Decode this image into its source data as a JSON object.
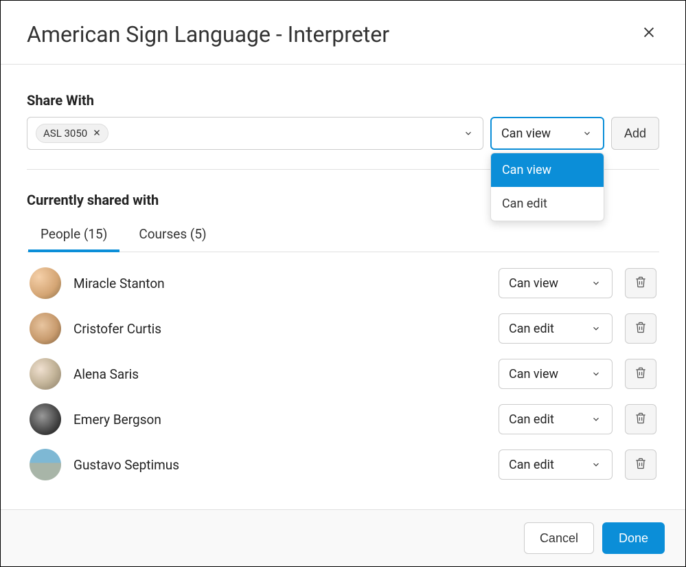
{
  "header": {
    "title": "American Sign Language - Interpreter"
  },
  "share": {
    "label": "Share With",
    "chip": "ASL 3050",
    "permission_selected": "Can view",
    "add_label": "Add",
    "dropdown_options": [
      "Can view",
      "Can edit"
    ]
  },
  "shared": {
    "label": "Currently shared with",
    "tabs": [
      {
        "label": "People (15)",
        "active": true
      },
      {
        "label": "Courses (5)",
        "active": false
      }
    ],
    "people": [
      {
        "name": "Miracle Stanton",
        "permission": "Can view"
      },
      {
        "name": "Cristofer Curtis",
        "permission": "Can edit"
      },
      {
        "name": "Alena Saris",
        "permission": "Can view"
      },
      {
        "name": "Emery Bergson",
        "permission": "Can edit"
      },
      {
        "name": "Gustavo Septimus",
        "permission": "Can edit"
      }
    ]
  },
  "footer": {
    "cancel": "Cancel",
    "done": "Done"
  }
}
